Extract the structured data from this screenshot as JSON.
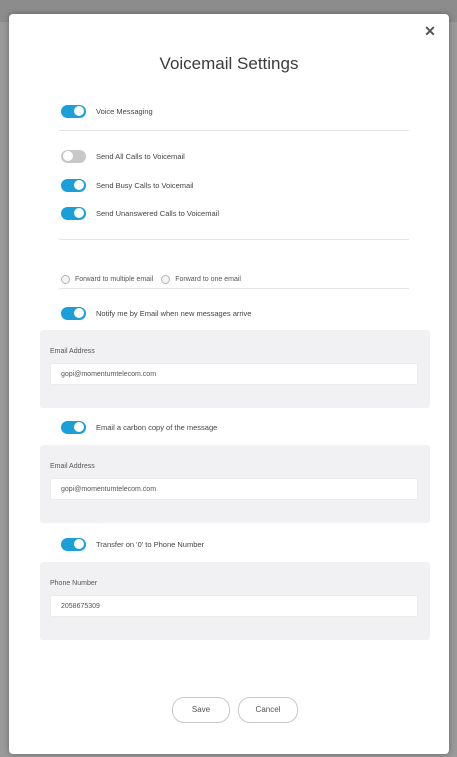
{
  "dialog": {
    "title": "Voicemail Settings",
    "close_glyph": "✕"
  },
  "toggles": {
    "voice_messaging": {
      "label": "Voice Messaging",
      "on": true
    },
    "send_all": {
      "label": "Send All Calls to Voicemail",
      "on": false
    },
    "send_busy": {
      "label": "Send Busy Calls to Voicemail",
      "on": true
    },
    "send_unanswered": {
      "label": "Send Unanswered Calls to Voicemail",
      "on": true
    },
    "notify_email": {
      "label": "Notify me by Email when new messages arrive",
      "on": true
    },
    "carbon_copy": {
      "label": "Email a carbon copy of the message",
      "on": true
    },
    "transfer_zero": {
      "label": "Transfer on '0' to Phone Number",
      "on": true
    }
  },
  "radios": {
    "forward_multiple": "Forward to multiple email",
    "forward_one": "Forward to one email"
  },
  "notify_panel": {
    "label": "Email Address",
    "value": "gopi@momentumtelecom.com"
  },
  "cc_panel": {
    "label": "Email Address",
    "value": "gopi@momentumtelecom.com"
  },
  "phone_panel": {
    "label": "Phone Number",
    "value": "2058675309"
  },
  "buttons": {
    "save": "Save",
    "cancel": "Cancel"
  },
  "colors": {
    "toggle_on": "#1a9fd9",
    "toggle_off": "#c8c8c8",
    "panel_bg": "#f1f1f3"
  }
}
